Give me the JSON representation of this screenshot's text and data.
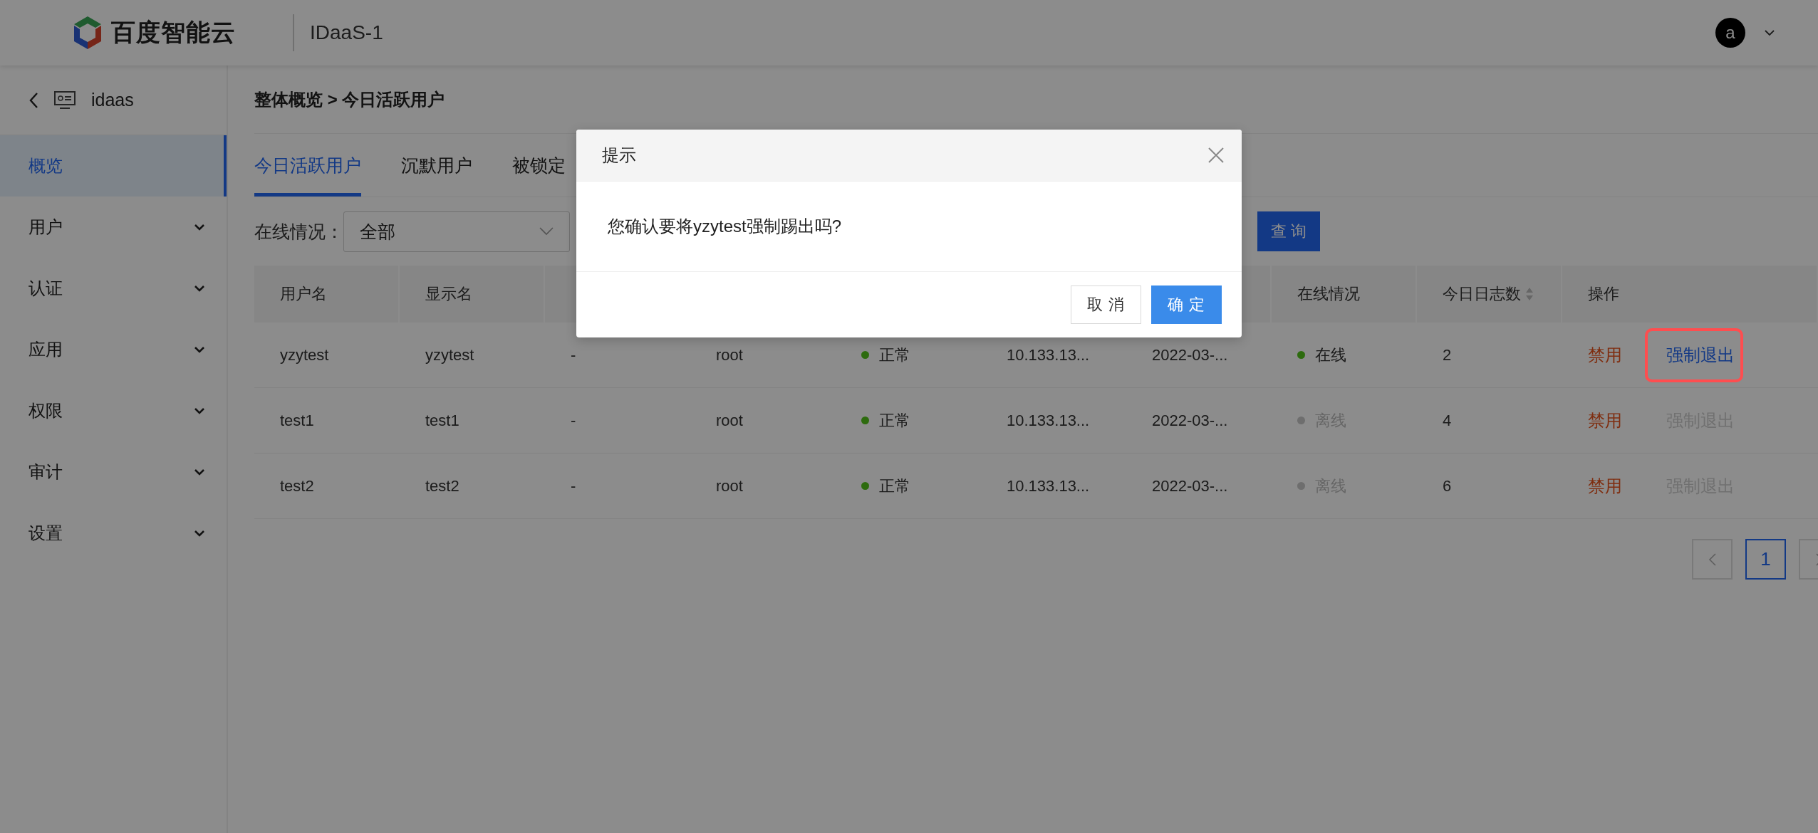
{
  "header": {
    "brand": "百度智能云",
    "product": "IDaaS-1",
    "user_initial": "a"
  },
  "sidebar": {
    "title": "idaas",
    "items": [
      {
        "label": "概览",
        "selected": true,
        "expandable": false
      },
      {
        "label": "用户",
        "selected": false,
        "expandable": true
      },
      {
        "label": "认证",
        "selected": false,
        "expandable": true
      },
      {
        "label": "应用",
        "selected": false,
        "expandable": true
      },
      {
        "label": "权限",
        "selected": false,
        "expandable": true
      },
      {
        "label": "审计",
        "selected": false,
        "expandable": true
      },
      {
        "label": "设置",
        "selected": false,
        "expandable": true
      }
    ]
  },
  "breadcrumb": "整体概览 > 今日活跃用户",
  "tabs": [
    {
      "label": "今日活跃用户",
      "selected": true
    },
    {
      "label": "沉默用户",
      "selected": false
    },
    {
      "label": "被锁定",
      "selected": false
    }
  ],
  "filter": {
    "label": "在线情况：",
    "value": "全部",
    "query_button": "查 询"
  },
  "table": {
    "columns": [
      {
        "label": "用户名"
      },
      {
        "label": "显示名"
      },
      {
        "label": "在线情况"
      },
      {
        "label": "今日日志数",
        "sortable": true
      },
      {
        "label": "操作"
      }
    ],
    "rows": [
      {
        "username": "yzytest",
        "display_name": "yzytest",
        "column_3": "-",
        "column_4": "root",
        "status": "正常",
        "status_ok": true,
        "column_6": "10.133.13...",
        "column_7": "2022-03-...",
        "online": true,
        "online_label": "在线",
        "log_count": "2",
        "actions": [
          {
            "label": "禁用",
            "kind": "danger",
            "disabled": false,
            "highlighted": false
          },
          {
            "label": "强制退出",
            "kind": "link",
            "disabled": false,
            "highlighted": true
          }
        ]
      },
      {
        "username": "test1",
        "display_name": "test1",
        "column_3": "-",
        "column_4": "root",
        "status": "正常",
        "status_ok": true,
        "column_6": "10.133.13...",
        "column_7": "2022-03-...",
        "online": false,
        "online_label": "离线",
        "log_count": "4",
        "actions": [
          {
            "label": "禁用",
            "kind": "danger",
            "disabled": false,
            "highlighted": false
          },
          {
            "label": "强制退出",
            "kind": "link",
            "disabled": true,
            "highlighted": false
          }
        ]
      },
      {
        "username": "test2",
        "display_name": "test2",
        "column_3": "-",
        "column_4": "root",
        "status": "正常",
        "status_ok": true,
        "column_6": "10.133.13...",
        "column_7": "2022-03-...",
        "online": false,
        "online_label": "离线",
        "log_count": "6",
        "actions": [
          {
            "label": "禁用",
            "kind": "danger",
            "disabled": false,
            "highlighted": false
          },
          {
            "label": "强制退出",
            "kind": "link",
            "disabled": true,
            "highlighted": false
          }
        ]
      }
    ]
  },
  "pagination": {
    "pages": [
      {
        "label": "1",
        "selected": true
      }
    ]
  },
  "dialog": {
    "title": "提示",
    "message": "您确认要将yzytest强制踢出吗?",
    "buttons": [
      {
        "label": "取 消",
        "kind": "default"
      },
      {
        "label": "确 定",
        "kind": "primary"
      }
    ]
  }
}
